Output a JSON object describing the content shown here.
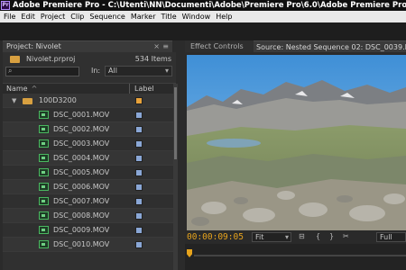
{
  "window": {
    "app_icon_text": "Pr",
    "title": "Adobe Premiere Pro - C:\\Utenti\\NN\\Documenti\\Adobe\\Premiere Pro\\6.0\\Adobe Premiere Pro Auto-Save\\Adobe"
  },
  "menu": [
    "File",
    "Edit",
    "Project",
    "Clip",
    "Sequence",
    "Marker",
    "Title",
    "Window",
    "Help"
  ],
  "project_panel": {
    "tab_label": "Project: Nivolet",
    "close_glyph": "×",
    "menu_glyph": "≡",
    "project_file": "Nivolet.prproj",
    "item_count": "534 Items",
    "search_placeholder": "",
    "in_label": "In:",
    "in_value": "All",
    "col_name": "Name",
    "col_label": "Label",
    "sort_arrow": "^",
    "folder": {
      "name": "100D3200",
      "color": "#e8a23a"
    },
    "clips": [
      {
        "name": "DSC_0001.MOV",
        "color": "#8aa7d6"
      },
      {
        "name": "DSC_0002.MOV",
        "color": "#8aa7d6"
      },
      {
        "name": "DSC_0003.MOV",
        "color": "#8aa7d6"
      },
      {
        "name": "DSC_0004.MOV",
        "color": "#8aa7d6"
      },
      {
        "name": "DSC_0005.MOV",
        "color": "#8aa7d6"
      },
      {
        "name": "DSC_0006.MOV",
        "color": "#8aa7d6"
      },
      {
        "name": "DSC_0007.MOV",
        "color": "#8aa7d6"
      },
      {
        "name": "DSC_0008.MOV",
        "color": "#8aa7d6"
      },
      {
        "name": "DSC_0009.MOV",
        "color": "#8aa7d6"
      },
      {
        "name": "DSC_0010.MOV",
        "color": "#8aa7d6"
      }
    ]
  },
  "monitor": {
    "tab_effect": "Effect Controls",
    "tab_source": "Source: Nested Sequence 02: DSC_0039.MOV: 00:0",
    "timecode": "00:00:09:05",
    "fit_label": "Fit",
    "full_label": "Full"
  },
  "colors": {
    "accent_timecode": "#e6a31c",
    "folder": "#e8a23a",
    "label_blue": "#8aa7d6"
  }
}
